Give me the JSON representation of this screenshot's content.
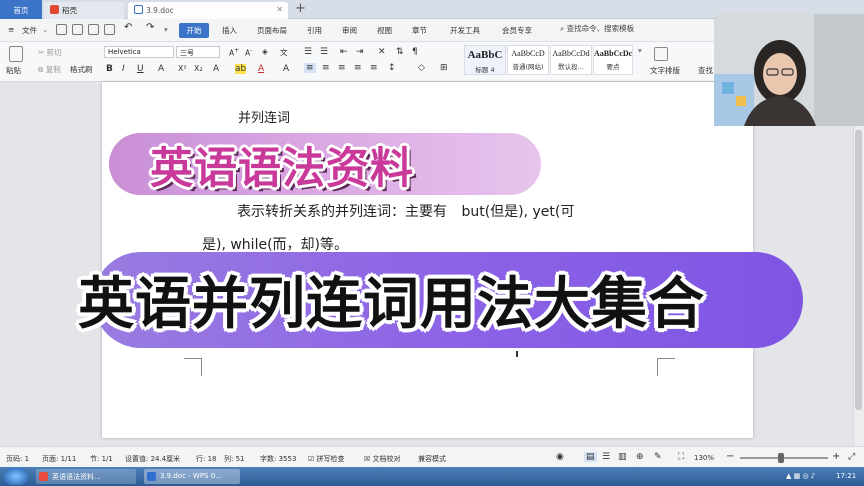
{
  "tabs": {
    "home": "首页",
    "daoke": "稻壳",
    "doc": "3.9.doc"
  },
  "menu": {
    "file": "文件",
    "start": "开始",
    "insert": "插入",
    "page_layout": "页面布局",
    "reference": "引用",
    "review": "审阅",
    "view": "视图",
    "chapter": "章节",
    "dev_tools": "开发工具",
    "member": "会员专享",
    "search_placeholder": "查找命令、搜索模板"
  },
  "ribbon": {
    "paste": "粘贴",
    "cut": "剪切",
    "copy": "复制",
    "format_painter": "格式刷",
    "font_name": "Helvetica",
    "font_size": "三号",
    "styles": [
      {
        "sample": "AaBbC",
        "name": "标题 4"
      },
      {
        "sample": "AaBbCcD",
        "name": "普通(网站)"
      },
      {
        "sample": "AaBbCcDd",
        "name": "默认段..."
      },
      {
        "sample": "AaBbCcDc",
        "name": "要点"
      }
    ],
    "text_layout": "文字排版",
    "find_replace": "查找"
  },
  "document": {
    "heading": "并列连词",
    "para_line1_cn": "表示转折关系的并列连词：主要有",
    "para_line1_en": "but(但是), yet(可",
    "para_line2": "是), while(而，却)等。"
  },
  "overlay": {
    "banner1": "英语语法资料",
    "banner2": "英语并列连词用法大集合"
  },
  "status": {
    "page_no": "页码: 1",
    "pages": "页面: 1/11",
    "section": "节: 1/1",
    "setting": "设置值: 24.4厘米",
    "row": "行: 18",
    "col": "列: 51",
    "words": "字数: 3553",
    "spell": "拼写检查",
    "proof": "文档校对",
    "compat": "兼容模式",
    "zoom": "130%"
  },
  "taskbar": {
    "task1": "英语语法资料...",
    "task2": "3.9.doc - WPS 0...",
    "clock": "17:21"
  },
  "colors": {
    "accent": "#3b73c8",
    "banner1_start": "#c98fd6",
    "banner1_text": "#c9399a",
    "banner2": "#8c63e6"
  }
}
